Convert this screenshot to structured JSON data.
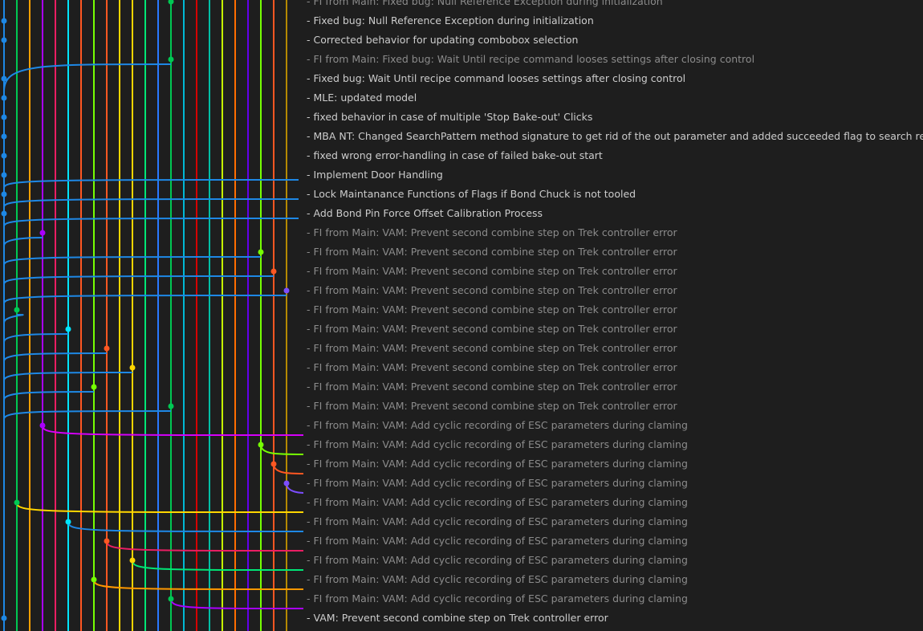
{
  "commits": [
    {
      "message": "- FI from Main: Fixed bug: Null Reference Exception during initialization",
      "kind": "merge"
    },
    {
      "message": "- Fixed bug: Null Reference Exception during initialization",
      "kind": "main"
    },
    {
      "message": "- Corrected behavior for updating combobox selection",
      "kind": "main"
    },
    {
      "message": "- FI from Main: Fixed bug: Wait Until recipe command looses settings after closing control",
      "kind": "merge"
    },
    {
      "message": "- Fixed bug: Wait Until recipe command looses settings after closing control",
      "kind": "main"
    },
    {
      "message": "- MLE: updated model",
      "kind": "main"
    },
    {
      "message": "- fixed behavior in case of multiple 'Stop Bake-out' Clicks",
      "kind": "main"
    },
    {
      "message": "- MBA NT: Changed SearchPattern method signature to get rid of the out parameter and added succeeded flag to search result",
      "kind": "main"
    },
    {
      "message": "- fixed wrong error-handling in case of failed bake-out start",
      "kind": "main"
    },
    {
      "message": "- Implement Door Handling",
      "kind": "main"
    },
    {
      "message": "- Lock Maintanance Functions of Flags if Bond Chuck is not tooled",
      "kind": "main"
    },
    {
      "message": "- Add Bond Pin Force Offset Calibration Process",
      "kind": "main"
    },
    {
      "message": "- FI from Main: VAM: Prevent second combine step on Trek controller error",
      "kind": "merge"
    },
    {
      "message": "- FI from Main: VAM: Prevent second combine step on Trek controller error",
      "kind": "merge"
    },
    {
      "message": "- FI from Main: VAM: Prevent second combine step on Trek controller error",
      "kind": "merge"
    },
    {
      "message": "- FI from Main: VAM: Prevent second combine step on Trek controller error",
      "kind": "merge"
    },
    {
      "message": "- FI from Main: VAM: Prevent second combine step on Trek controller error",
      "kind": "merge"
    },
    {
      "message": "- FI from Main: VAM: Prevent second combine step on Trek controller error",
      "kind": "merge"
    },
    {
      "message": "- FI from Main: VAM: Prevent second combine step on Trek controller error",
      "kind": "merge"
    },
    {
      "message": "- FI from Main: VAM: Prevent second combine step on Trek controller error",
      "kind": "merge"
    },
    {
      "message": "- FI from Main: VAM: Prevent second combine step on Trek controller error",
      "kind": "merge"
    },
    {
      "message": "- FI from Main: VAM: Prevent second combine step on Trek controller error",
      "kind": "merge"
    },
    {
      "message": "- FI from Main: VAM: Add cyclic recording of ESC parameters during claming",
      "kind": "merge"
    },
    {
      "message": "- FI from Main: VAM: Add cyclic recording of ESC parameters during claming",
      "kind": "merge"
    },
    {
      "message": "- FI from Main: VAM: Add cyclic recording of ESC parameters during claming",
      "kind": "merge"
    },
    {
      "message": "- FI from Main: VAM: Add cyclic recording of ESC parameters during claming",
      "kind": "merge"
    },
    {
      "message": "- FI from Main: VAM: Add cyclic recording of ESC parameters during claming",
      "kind": "merge"
    },
    {
      "message": "- FI from Main: VAM: Add cyclic recording of ESC parameters during claming",
      "kind": "merge"
    },
    {
      "message": "- FI from Main: VAM: Add cyclic recording of ESC parameters during claming",
      "kind": "merge"
    },
    {
      "message": "- FI from Main: VAM: Add cyclic recording of ESC parameters during claming",
      "kind": "merge"
    },
    {
      "message": "- FI from Main: VAM: Add cyclic recording of ESC parameters during claming",
      "kind": "merge"
    },
    {
      "message": "- FI from Main: VAM: Add cyclic recording of ESC parameters during claming",
      "kind": "merge"
    },
    {
      "message": "- VAM: Prevent second combine step on Trek controller error",
      "kind": "main"
    }
  ],
  "lane_colors": [
    "#1e88e5",
    "#00c853",
    "#ffa000",
    "#aa00ff",
    "#e91e63",
    "#00e5ff",
    "#ff5722",
    "#76ff03",
    "#ff9800",
    "#ffd600",
    "#d500f9",
    "#00e676",
    "#2979ff",
    "#ff3d00",
    "#00b8d4",
    "#d50000",
    "#00bfa5",
    "#c6ff00",
    "#ff6d00",
    "#6200ea",
    "#8d6e63",
    "#ffab00"
  ],
  "graph": {
    "nodes": [
      {
        "row": 0,
        "lane": 13
      },
      {
        "row": 1,
        "lane": 0
      },
      {
        "row": 2,
        "lane": 0
      },
      {
        "row": 3,
        "lane": 13
      },
      {
        "row": 4,
        "lane": 0
      },
      {
        "row": 5,
        "lane": 0
      },
      {
        "row": 6,
        "lane": 0
      },
      {
        "row": 7,
        "lane": 0
      },
      {
        "row": 8,
        "lane": 0
      },
      {
        "row": 9,
        "lane": 0
      },
      {
        "row": 10,
        "lane": 0
      },
      {
        "row": 11,
        "lane": 0
      },
      {
        "row": 12,
        "lane": 3
      },
      {
        "row": 13,
        "lane": 20
      },
      {
        "row": 14,
        "lane": 21
      },
      {
        "row": 15,
        "lane": 22
      },
      {
        "row": 16,
        "lane": 1
      },
      {
        "row": 17,
        "lane": 5
      },
      {
        "row": 18,
        "lane": 8
      },
      {
        "row": 19,
        "lane": 10
      },
      {
        "row": 20,
        "lane": 7
      },
      {
        "row": 21,
        "lane": 13
      },
      {
        "row": 22,
        "lane": 3
      },
      {
        "row": 23,
        "lane": 20
      },
      {
        "row": 24,
        "lane": 21
      },
      {
        "row": 25,
        "lane": 22
      },
      {
        "row": 26,
        "lane": 1
      },
      {
        "row": 27,
        "lane": 5
      },
      {
        "row": 28,
        "lane": 8
      },
      {
        "row": 29,
        "lane": 10
      },
      {
        "row": 30,
        "lane": 7
      },
      {
        "row": 31,
        "lane": 13
      },
      {
        "row": 32,
        "lane": 0
      }
    ],
    "lane_color_map": {
      "0": "#1e88e5",
      "1": "#00c853",
      "3": "#aa00ff",
      "5": "#00e5ff",
      "7": "#76ff03",
      "8": "#ff5722",
      "10": "#ffd600",
      "13": "#00c853",
      "20": "#76ff03",
      "21": "#ff5722",
      "22": "#7c4dff"
    }
  }
}
